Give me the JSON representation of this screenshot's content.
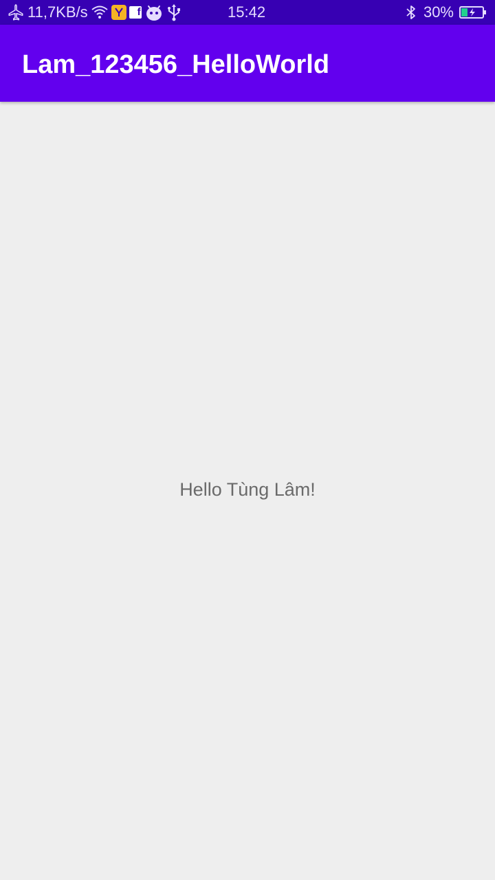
{
  "status_bar": {
    "net_speed": "11,7KB/s",
    "time": "15:42",
    "battery_percent": "30%",
    "battery_level": 0.3,
    "battery_color": "#21d08e",
    "notification_icons": [
      "airplane-icon",
      "wifi-icon",
      "app-notification-icon",
      "facebook-icon",
      "android-debug-icon",
      "usb-icon"
    ],
    "right_icons": [
      "bluetooth-icon",
      "battery-charging-icon"
    ]
  },
  "app_bar": {
    "title": "Lam_123456_HelloWorld",
    "color": "#6200ee"
  },
  "main": {
    "greeting": "Hello Tùng Lâm!"
  }
}
